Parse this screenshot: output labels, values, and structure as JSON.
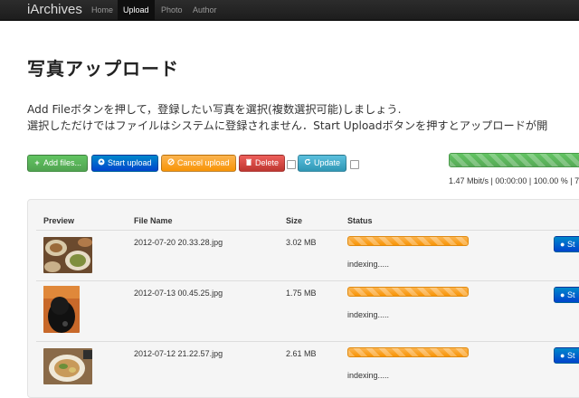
{
  "navbar": {
    "brand": "iArchives",
    "items": [
      {
        "label": "Home",
        "active": false
      },
      {
        "label": "Upload",
        "active": true
      },
      {
        "label": "Photo",
        "active": false
      },
      {
        "label": "Author",
        "active": false
      }
    ]
  },
  "page": {
    "title": "写真アップロード",
    "desc_line1": "Add Fileボタンを押して，登録したい写真を選択(複数選択可能)しましょう.",
    "desc_line2": "選択しただけではファイルはシステムに登録されません．Start Uploadボタンを押すとアップロードが開"
  },
  "toolbar": {
    "add": {
      "icon": "plus-icon",
      "label": "Add files..."
    },
    "start": {
      "icon": "upload-circle-icon",
      "label": "Start upload"
    },
    "cancel": {
      "icon": "ban-icon",
      "label": "Cancel upload"
    },
    "delete": {
      "icon": "trash-icon",
      "label": "Delete"
    },
    "update": {
      "icon": "refresh-icon",
      "label": "Update"
    }
  },
  "global_progress": {
    "percent": 100,
    "stats": "1.47 Mbit/s | 00:00:00 | 100.00 % | 7."
  },
  "table": {
    "headers": {
      "preview": "Preview",
      "name": "File Name",
      "size": "Size",
      "status": "Status"
    },
    "rows": [
      {
        "name": "2012-07-20 20.33.28.jpg",
        "size": "3.02 MB",
        "status": "indexing.....",
        "progress": 100,
        "button": "St"
      },
      {
        "name": "2012-07-13 00.45.25.jpg",
        "size": "1.75 MB",
        "status": "indexing.....",
        "progress": 100,
        "button": "St"
      },
      {
        "name": "2012-07-12 21.22.57.jpg",
        "size": "2.61 MB",
        "status": "indexing.....",
        "progress": 100,
        "button": "St"
      }
    ]
  },
  "colors": {
    "navbar": "#1d1d1d",
    "green": "#51a351",
    "blue": "#0044cc",
    "orange": "#f89406",
    "red": "#bd362f",
    "cyan": "#2f96b4"
  }
}
